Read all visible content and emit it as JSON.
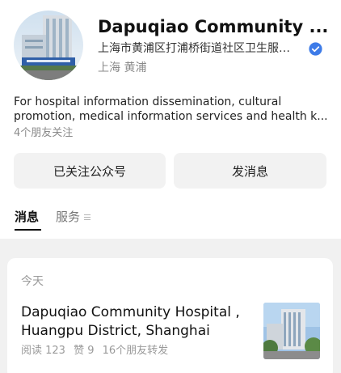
{
  "profile": {
    "name": "Dapuqiao Community ...",
    "organization": "上海市黄浦区打浦桥街道社区卫生服…",
    "location": "上海 黄浦",
    "description": "For hospital information dissemination, cultural promotion, medical information services and health k...",
    "friends_follow": "4个朋友关注"
  },
  "actions": {
    "followed_label": "已关注公众号",
    "message_label": "发消息"
  },
  "tabs": {
    "messages": "消息",
    "services": "服务"
  },
  "feed": {
    "date": "今天",
    "article": {
      "title": "Dapuqiao Community Hospital , Huangpu District, Shanghai",
      "reads": "阅读 123",
      "likes": "赞 9",
      "shares": "16个朋友转发"
    }
  },
  "colors": {
    "verified": "#3d7be8",
    "feed_background": "#f1f1f1",
    "button_background": "#f2f2f2"
  },
  "icons": {
    "verified": "verified-badge-icon",
    "services_menu": "menu-icon"
  }
}
